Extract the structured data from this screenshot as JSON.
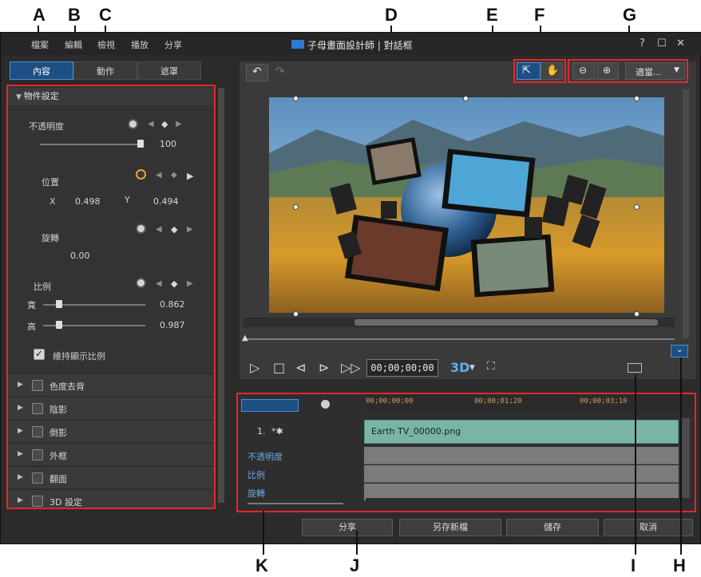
{
  "callouts": {
    "top": [
      "A",
      "B",
      "C",
      "D",
      "E",
      "F",
      "G"
    ],
    "bottom": [
      "K",
      "J",
      "I",
      "H"
    ]
  },
  "menu": {
    "items": [
      "檔案",
      "編輯",
      "檢視",
      "播放",
      "分享"
    ],
    "title": "子母畫面設計師 | 對話框",
    "help": "?",
    "maximize": "☐",
    "close": "✕"
  },
  "tabs": [
    "內容",
    "動作",
    "遮罩"
  ],
  "left": {
    "section_title": "物件設定",
    "opacity": {
      "label": "不透明度",
      "value": "100"
    },
    "position": {
      "label": "位置",
      "x_label": "X",
      "x": "0.498",
      "y_label": "Y",
      "y": "0.494"
    },
    "rotation": {
      "label": "旋轉",
      "value": "0.00"
    },
    "scale": {
      "label": "比例",
      "width_label": "寬",
      "width": "0.862",
      "height_label": "高",
      "height": "0.987"
    },
    "keep_ratio": "維持顯示比例",
    "collapsed": [
      "色度去背",
      "陰影",
      "倒影",
      "外框",
      "翻面",
      "3D 設定"
    ]
  },
  "preview": {
    "undo": "↶",
    "redo": "↷",
    "zoom_value": "適當...",
    "timecode": "00;00;00;00",
    "mode_3d": "3D"
  },
  "timeline": {
    "ruler": [
      "00;00;00;00",
      "00;00;01;20",
      "00;00;03;10"
    ],
    "track_label": "1.",
    "clip_name": "Earth TV_00000.png",
    "rows": [
      "不透明度",
      "比例",
      "旋轉"
    ]
  },
  "bottom": {
    "share": "分享",
    "save_as": "另存新檔",
    "save": "儲存",
    "cancel": "取消"
  },
  "colors": {
    "accent": "#1d4f83",
    "annotation": "#e8262c",
    "clip": "#7ab4a6"
  }
}
